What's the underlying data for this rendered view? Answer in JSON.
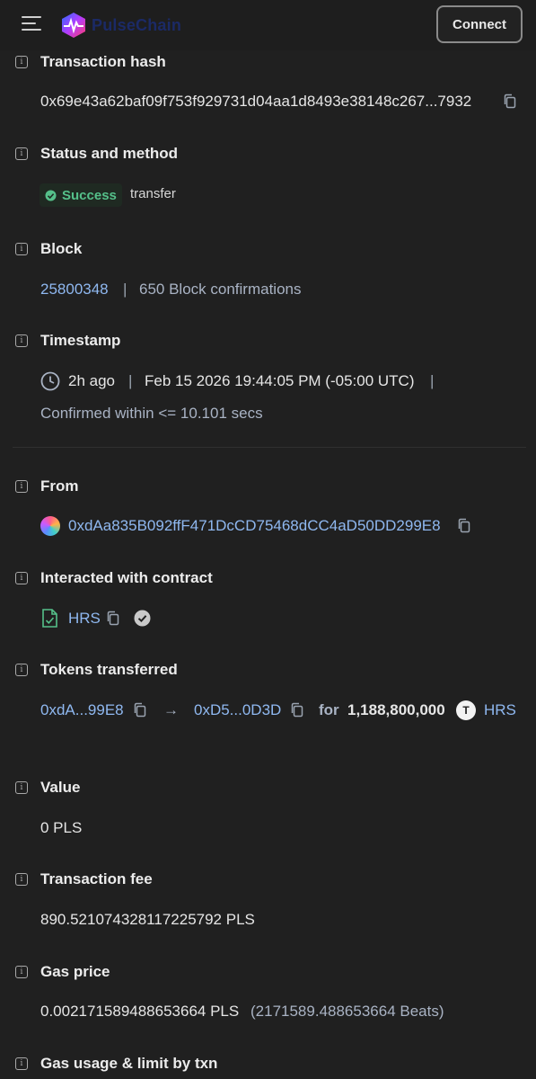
{
  "header": {
    "logo_text": "PulseChain",
    "connect_label": "Connect"
  },
  "tx_hash": {
    "label": "Transaction hash",
    "value": "0x69e43a62baf09f753f929731d04aa1d8493e38148c267...7932"
  },
  "status": {
    "label": "Status and method",
    "badge": "Success",
    "method": "transfer"
  },
  "block": {
    "label": "Block",
    "number": "25800348",
    "separator": "|",
    "confirmations": "650 Block confirmations"
  },
  "timestamp": {
    "label": "Timestamp",
    "ago": "2h ago",
    "separator": "|",
    "datetime": "Feb 15 2026 19:44:05 PM (-05:00 UTC)",
    "confirmed": "Confirmed within <= 10.101 secs"
  },
  "from": {
    "label": "From",
    "address": "0xdAa835B092ffF471DcCD75468dCC4aD50DD299E8"
  },
  "contract": {
    "label": "Interacted with contract",
    "name": "HRS"
  },
  "tokens": {
    "label": "Tokens transferred",
    "from": "0xdA...99E8",
    "arrow": "→",
    "to": "0xD5...0D3D",
    "for_word": "for",
    "amount": "1,188,800,000",
    "token_letter": "T",
    "token_symbol": "HRS"
  },
  "value": {
    "label": "Value",
    "amount": "0 PLS"
  },
  "fee": {
    "label": "Transaction fee",
    "amount": "890.521074328117225792 PLS"
  },
  "gas_price": {
    "label": "Gas price",
    "amount": "0.002171589488653664 PLS",
    "beats": "(2171589.488653664 Beats)"
  },
  "gas_usage": {
    "label": "Gas usage & limit by txn"
  },
  "colors": {
    "background": "#202020",
    "link": "#8fb8f0",
    "success": "#55c08a",
    "muted": "#a9b3c4"
  }
}
